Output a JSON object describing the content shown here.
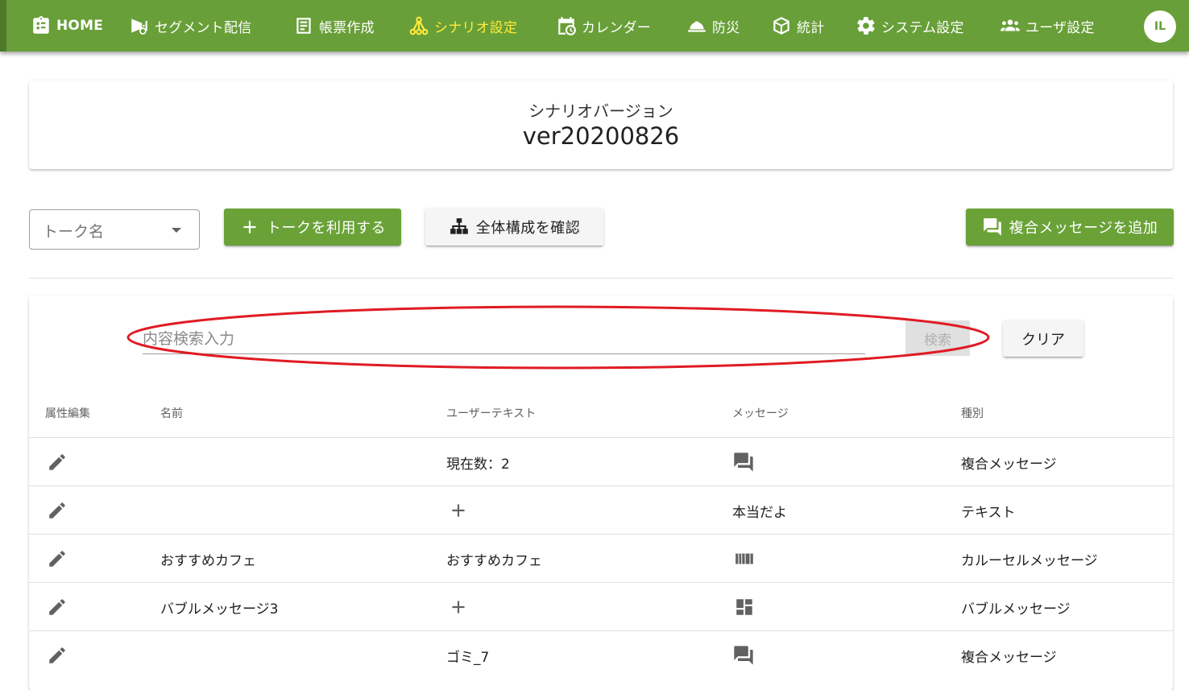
{
  "nav": {
    "items": [
      {
        "label": "HOME",
        "icon": "clipboard-icon"
      },
      {
        "label": "セグメント配信",
        "icon": "megaphone-icon"
      },
      {
        "label": "帳票作成",
        "icon": "document-icon"
      },
      {
        "label": "シナリオ設定",
        "icon": "scenario-tree-icon"
      },
      {
        "label": "カレンダー",
        "icon": "calendar-clock-icon"
      },
      {
        "label": "防災",
        "icon": "helmet-icon"
      },
      {
        "label": "統計",
        "icon": "cube-icon"
      },
      {
        "label": "システム設定",
        "icon": "gear-icon"
      },
      {
        "label": "ユーザ設定",
        "icon": "users-icon"
      }
    ],
    "active_label": "シナリオ設定",
    "avatar_text": "IL"
  },
  "version": {
    "label": "シナリオバージョン",
    "value": "ver20200826"
  },
  "toolbar": {
    "talk_select_placeholder": "トーク名",
    "use_talk_label": "トークを利用する",
    "overview_label": "全体構成を確認",
    "add_composite_label": "複合メッセージを追加"
  },
  "search": {
    "placeholder": "内容検索入力",
    "search_label": "検索",
    "clear_label": "クリア"
  },
  "table": {
    "headers": [
      "属性編集",
      "名前",
      "ユーザーテキスト",
      "メッセージ",
      "種別"
    ],
    "rows": [
      {
        "name": "",
        "user_text": "現在数：2",
        "message": "",
        "message_icon": "chat-icon",
        "type": "複合メッセージ"
      },
      {
        "name": "",
        "user_text": "",
        "user_text_icon": "plus-icon",
        "message": "本当だよ",
        "type": "テキスト"
      },
      {
        "name": "おすすめカフェ",
        "user_text": "おすすめカフェ",
        "message": "",
        "message_icon": "carousel-icon",
        "type": "カルーセルメッセージ"
      },
      {
        "name": "バブルメッセージ3",
        "user_text": "",
        "user_text_icon": "plus-icon",
        "message": "",
        "message_icon": "dashboard-icon",
        "type": "バブルメッセージ"
      },
      {
        "name": "",
        "user_text": "ゴミ_7",
        "message": "",
        "message_icon": "chat-icon",
        "type": "複合メッセージ"
      }
    ]
  },
  "colors": {
    "nav_bg": "#689f38",
    "active": "#ffeb3b",
    "button_green": "#6aa237",
    "annotation_red": "#e01b24"
  }
}
